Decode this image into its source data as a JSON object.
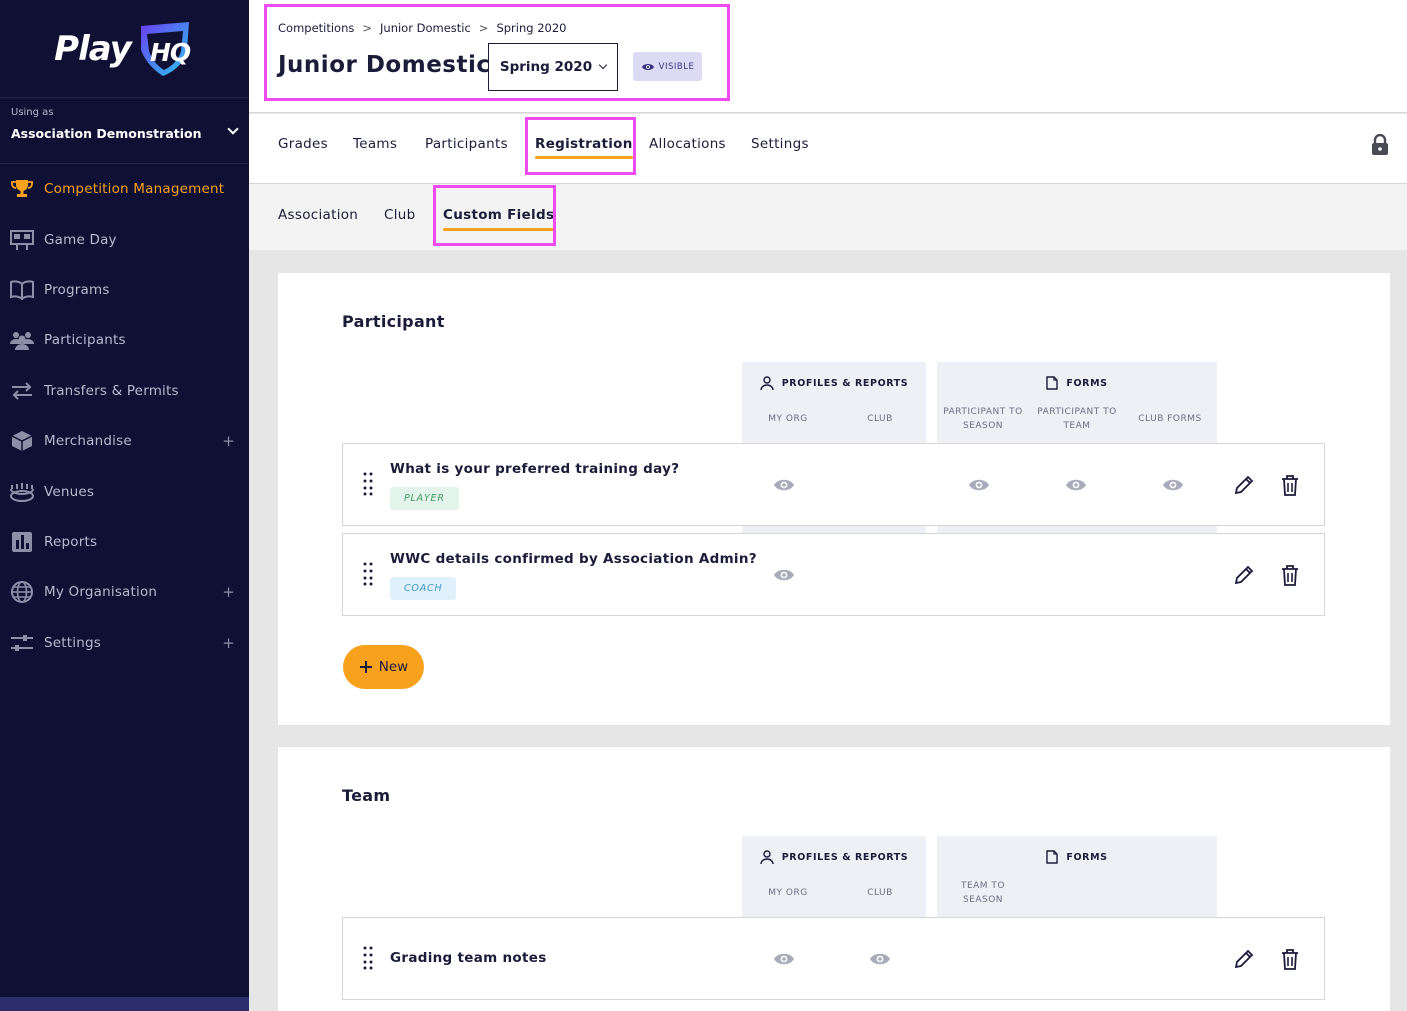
{
  "sidebar": {
    "logo": "PlayHQ",
    "using_as_label": "Using as",
    "org_name": "Association Demonstration",
    "items": [
      {
        "label": "Competition Management",
        "icon": "trophy-icon",
        "active": true
      },
      {
        "label": "Game Day",
        "icon": "scoreboard-icon"
      },
      {
        "label": "Programs",
        "icon": "book-icon"
      },
      {
        "label": "Participants",
        "icon": "people-icon"
      },
      {
        "label": "Transfers & Permits",
        "icon": "transfer-arrows-icon"
      },
      {
        "label": "Merchandise",
        "icon": "box-icon",
        "expandable": "+"
      },
      {
        "label": "Venues",
        "icon": "stadium-icon"
      },
      {
        "label": "Reports",
        "icon": "bar-chart-icon"
      },
      {
        "label": "My Organisation",
        "icon": "globe-icon",
        "expandable": "+"
      },
      {
        "label": "Settings",
        "icon": "sliders-icon",
        "expandable": "+"
      }
    ]
  },
  "header": {
    "breadcrumbs": [
      "Competitions",
      "Junior Domestic",
      "Spring 2020"
    ],
    "breadcrumb_sep": ">",
    "title": "Junior Domestic",
    "season": "Spring 2020",
    "visibility": "VISIBLE"
  },
  "tabs": [
    "Grades",
    "Teams",
    "Participants",
    "Registration",
    "Allocations",
    "Settings"
  ],
  "active_tab": "Registration",
  "subtabs": [
    "Association",
    "Club",
    "Custom Fields"
  ],
  "active_subtab": "Custom Fields",
  "participant_section": {
    "title": "Participant",
    "profiles_group": {
      "label": "PROFILES & REPORTS",
      "columns": [
        "MY ORG",
        "CLUB"
      ]
    },
    "forms_group": {
      "label": "FORMS",
      "columns": [
        "PARTICIPANT TO SEASON",
        "PARTICIPANT TO TEAM",
        "CLUB FORMS"
      ]
    },
    "fields": [
      {
        "name": "What is your preferred training day?",
        "tag": "PLAYER",
        "visible_in": [
          "MY ORG",
          "PARTICIPANT TO SEASON",
          "PARTICIPANT TO TEAM",
          "CLUB FORMS"
        ]
      },
      {
        "name": "WWC details confirmed by Association Admin?",
        "tag": "COACH",
        "visible_in": [
          "MY ORG"
        ]
      }
    ],
    "new_button": "New"
  },
  "team_section": {
    "title": "Team",
    "profiles_group": {
      "label": "PROFILES & REPORTS",
      "columns": [
        "MY ORG",
        "CLUB"
      ]
    },
    "forms_group": {
      "label": "FORMS",
      "columns": [
        "TEAM TO SEASON"
      ]
    },
    "fields": [
      {
        "name": "Grading team notes",
        "visible_in": [
          "MY ORG",
          "CLUB"
        ]
      }
    ]
  },
  "colors": {
    "sidebar_bg": "#0f1034",
    "accent": "#f7a11d",
    "highlight": "#ee4cf0",
    "badge_bg": "#dcdaf5"
  }
}
